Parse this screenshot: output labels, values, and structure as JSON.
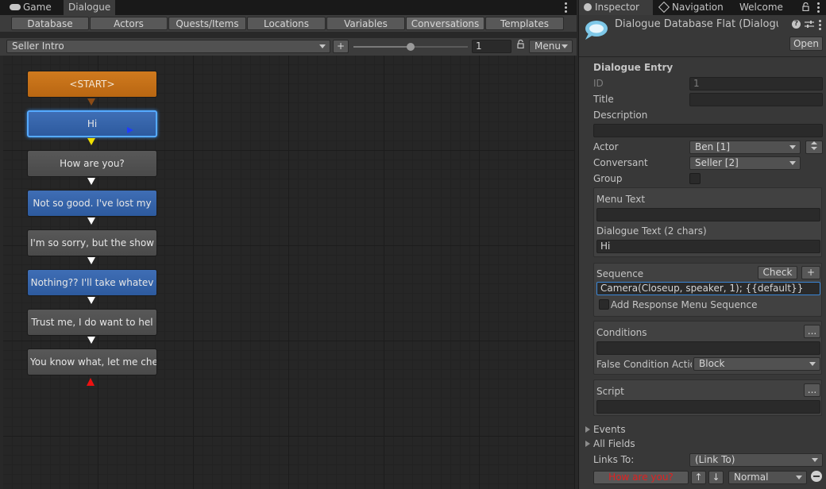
{
  "editor": {
    "tabs": [
      {
        "label": "Game",
        "icon": "gamepad-icon"
      },
      {
        "label": "Dialogue",
        "icon": ""
      }
    ],
    "toolbar_tabs": [
      "Database",
      "Actors",
      "Quests/Items",
      "Locations",
      "Variables",
      "Conversations",
      "Templates"
    ],
    "active_toolbar_tab": "Conversations",
    "conversation": {
      "selected": "Seller Intro",
      "add_label": "+",
      "zoom": 0.5,
      "entry_id": "1",
      "menu_label": "Menu"
    },
    "nodes": [
      {
        "label": "<START>",
        "type": "start"
      },
      {
        "label": "Hi",
        "type": "pc",
        "selected": true
      },
      {
        "label": "How are you?",
        "type": "npc"
      },
      {
        "label": "Not so good. I've lost my",
        "type": "pc"
      },
      {
        "label": "I'm so sorry, but the show",
        "type": "npc"
      },
      {
        "label": "Nothing?? I'll take whatev",
        "type": "pc"
      },
      {
        "label": "Trust me, I do want to hel",
        "type": "npc"
      },
      {
        "label": "You know what, let me chec",
        "type": "npc"
      }
    ]
  },
  "inspector": {
    "tabs": [
      "Inspector",
      "Navigation",
      "Welcome"
    ],
    "object_title": "Dialogue Database Flat (Dialogue I",
    "open_label": "Open",
    "section_title": "Dialogue Entry",
    "fields": {
      "id_label": "ID",
      "id_value": "1",
      "title_label": "Title",
      "title_value": "",
      "description_label": "Description",
      "description_value": "",
      "actor_label": "Actor",
      "actor_value": "Ben [1]",
      "conversant_label": "Conversant",
      "conversant_value": "Seller [2]",
      "group_label": "Group",
      "menu_text_label": "Menu Text",
      "menu_text_value": "",
      "dialogue_text_label": "Dialogue Text (2 chars)",
      "dialogue_text_value": "Hi",
      "sequence_label": "Sequence",
      "check_label": "Check",
      "sequence_add_label": "+",
      "sequence_value": "Camera(Closeup, speaker, 1); {{default}}",
      "add_response_label": "Add Response Menu Sequence",
      "conditions_label": "Conditions",
      "conditions_value": "",
      "ellipsis_label": "...",
      "false_condition_label": "False Condition Actio",
      "false_condition_value": "Block",
      "script_label": "Script",
      "script_value": "",
      "events_label": "Events",
      "all_fields_label": "All Fields",
      "links_to_label": "Links To:",
      "links_to_value": "(Link To)",
      "link_target": "How are you?",
      "link_priority": "Normal"
    }
  },
  "colors": {
    "start_node": "#c8701a",
    "npc_node": "#525252",
    "pc_node": "#3565aa",
    "selection": "#55aaff",
    "link_target_text": "#e02020"
  }
}
